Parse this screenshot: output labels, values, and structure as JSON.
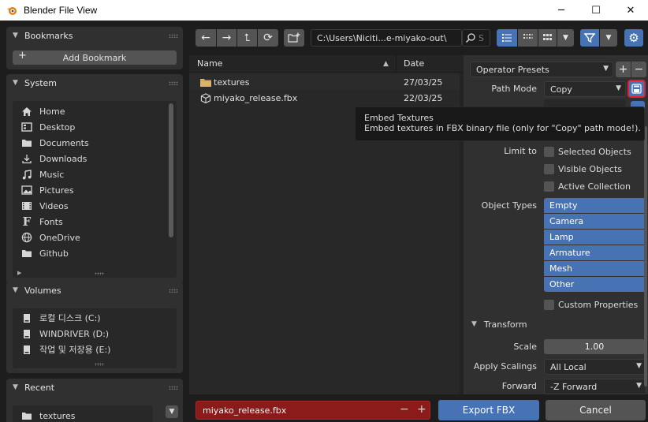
{
  "window": {
    "title": "Blender File View",
    "minimize": "─",
    "maximize": "☐",
    "close": "✕"
  },
  "sidebar": {
    "bookmarks": {
      "title": "Bookmarks",
      "add_label": "Add Bookmark"
    },
    "system": {
      "title": "System",
      "items": [
        {
          "label": "Home",
          "icon": "home-icon"
        },
        {
          "label": "Desktop",
          "icon": "desktop-icon"
        },
        {
          "label": "Documents",
          "icon": "documents-icon"
        },
        {
          "label": "Downloads",
          "icon": "downloads-icon"
        },
        {
          "label": "Music",
          "icon": "music-icon"
        },
        {
          "label": "Pictures",
          "icon": "pictures-icon"
        },
        {
          "label": "Videos",
          "icon": "videos-icon"
        },
        {
          "label": "Fonts",
          "icon": "fonts-icon"
        },
        {
          "label": "OneDrive",
          "icon": "globe-icon"
        },
        {
          "label": "Github",
          "icon": "folder-icon"
        }
      ]
    },
    "volumes": {
      "title": "Volumes",
      "items": [
        {
          "label": "로컬 디스크 (C:)",
          "icon": "drive-icon"
        },
        {
          "label": "WINDRIVER (D:)",
          "icon": "drive-icon"
        },
        {
          "label": "작업 및 저장용 (E:)",
          "icon": "drive-icon"
        }
      ]
    },
    "recent": {
      "title": "Recent",
      "items": [
        {
          "label": "textures",
          "icon": "folder-icon"
        }
      ]
    }
  },
  "toolbar": {
    "path": "C:\\Users\\Niciti...e-miyako-out\\",
    "search_placeholder": "S"
  },
  "filelist": {
    "col_name": "Name",
    "col_date": "Date",
    "files": [
      {
        "name": "textures",
        "date": "27/03/25",
        "type": "folder"
      },
      {
        "name": "miyako_release.fbx",
        "date": "22/03/25",
        "type": "mesh"
      }
    ]
  },
  "options": {
    "preset_label": "Operator Presets",
    "path_mode_label": "Path Mode",
    "path_mode_value": "Copy",
    "limit_to_label": "Limit to",
    "limit_checks": [
      "Selected Objects",
      "Visible Objects",
      "Active Collection"
    ],
    "object_types_label": "Object Types",
    "object_types": [
      "Empty",
      "Camera",
      "Lamp",
      "Armature",
      "Mesh",
      "Other"
    ],
    "custom_properties": "Custom Properties",
    "transform_label": "Transform",
    "scale_label": "Scale",
    "scale_value": "1.00",
    "apply_scalings_label": "Apply Scalings",
    "apply_scalings_value": "All Local",
    "forward_label": "Forward",
    "forward_value": "-Z Forward"
  },
  "tooltip": {
    "title": "Embed Textures",
    "description": "Embed textures in FBX binary file (only for \"Copy\" path mode!)."
  },
  "bottom": {
    "filename": "miyako_release.fbx",
    "export_label": "Export FBX",
    "cancel_label": "Cancel"
  },
  "colors": {
    "accent": "#4772b3",
    "filename_bg": "#8b1a1a",
    "highlight_box": "#e0202a"
  }
}
